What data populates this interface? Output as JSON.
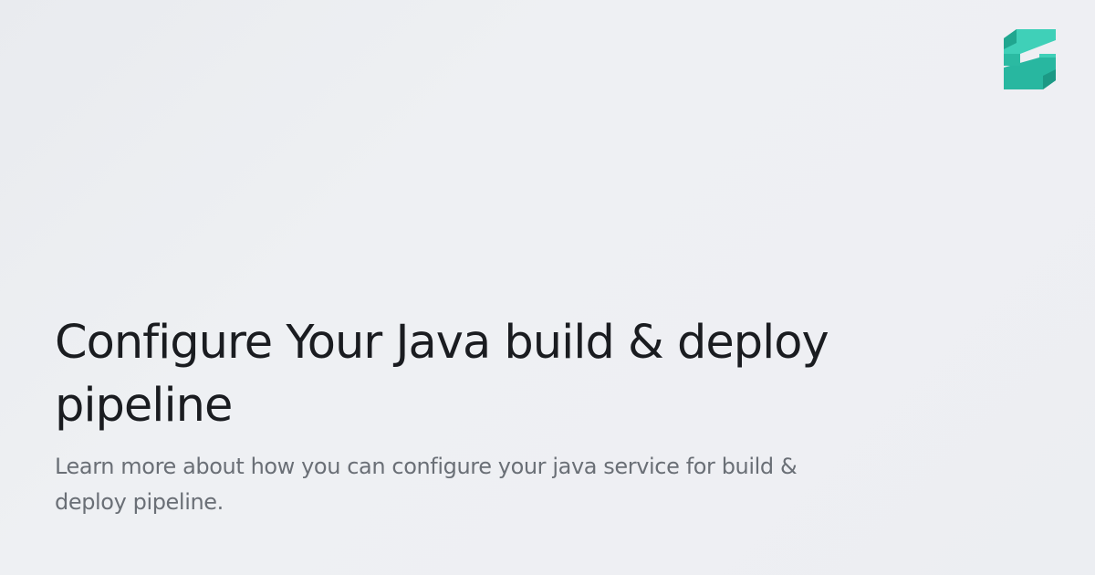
{
  "logo": {
    "icon": "zeet-logo-icon",
    "color_light": "#3fd0b8",
    "color_dark": "#20a68f"
  },
  "article": {
    "title": "Configure Your Java build & deploy pipeline",
    "description": "Learn more about how you can configure your java service for build & deploy pipeline."
  },
  "colors": {
    "background": "#eceef2",
    "title_text": "#1a1c20",
    "description_text": "#6a6f76"
  }
}
